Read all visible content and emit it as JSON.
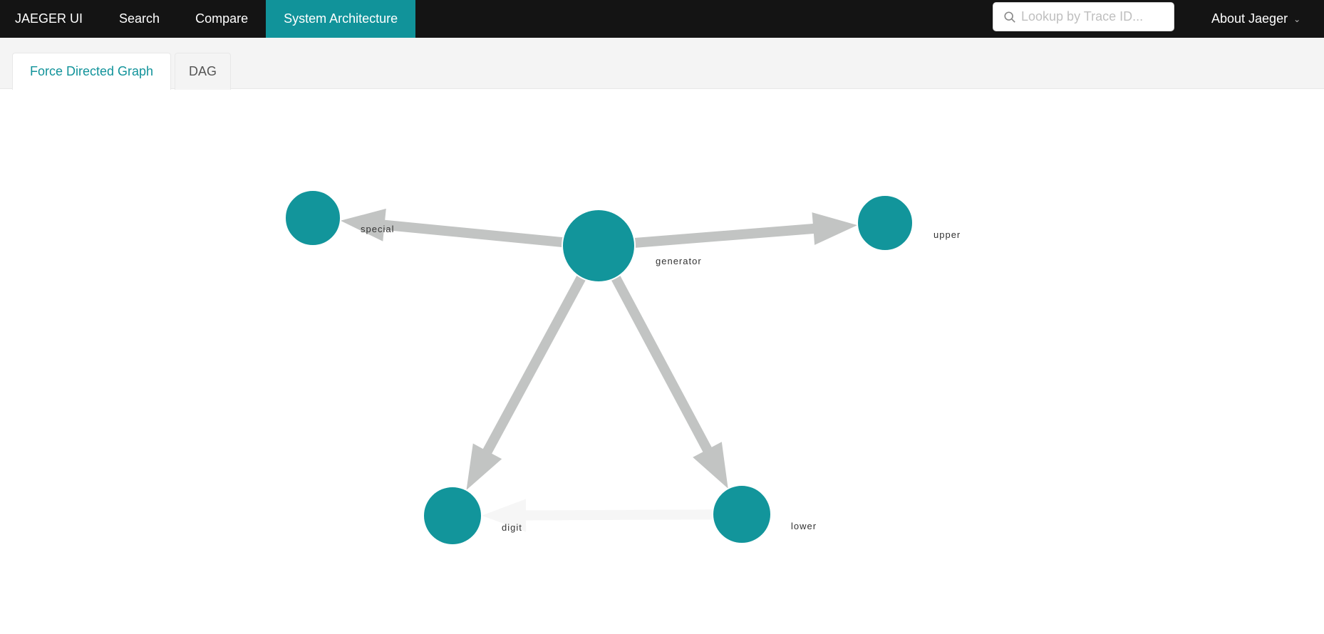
{
  "nav": {
    "brand": "JAEGER UI",
    "items": [
      {
        "label": "Search",
        "active": false
      },
      {
        "label": "Compare",
        "active": false
      },
      {
        "label": "System Architecture",
        "active": true
      }
    ],
    "search_placeholder": "Lookup by Trace ID...",
    "search_value": "",
    "about_label": "About Jaeger",
    "about_icon": "chevron-down-icon"
  },
  "tabs": [
    {
      "label": "Force Directed Graph",
      "active": true
    },
    {
      "label": "DAG",
      "active": false
    }
  ],
  "colors": {
    "accent": "#11939a",
    "node": "#12959b",
    "edge": "#c2c4c3",
    "edge_faint": "#f6f6f6",
    "header_bg": "#141414"
  },
  "graph": {
    "nodes": [
      {
        "id": "generator",
        "label": "generator"
      },
      {
        "id": "special",
        "label": "special"
      },
      {
        "id": "upper",
        "label": "upper"
      },
      {
        "id": "digit",
        "label": "digit"
      },
      {
        "id": "lower",
        "label": "lower"
      }
    ],
    "edges": [
      {
        "source": "generator",
        "target": "special",
        "faint": false
      },
      {
        "source": "generator",
        "target": "upper",
        "faint": false
      },
      {
        "source": "generator",
        "target": "digit",
        "faint": false
      },
      {
        "source": "generator",
        "target": "lower",
        "faint": false
      },
      {
        "source": "lower",
        "target": "digit",
        "faint": true
      }
    ]
  }
}
